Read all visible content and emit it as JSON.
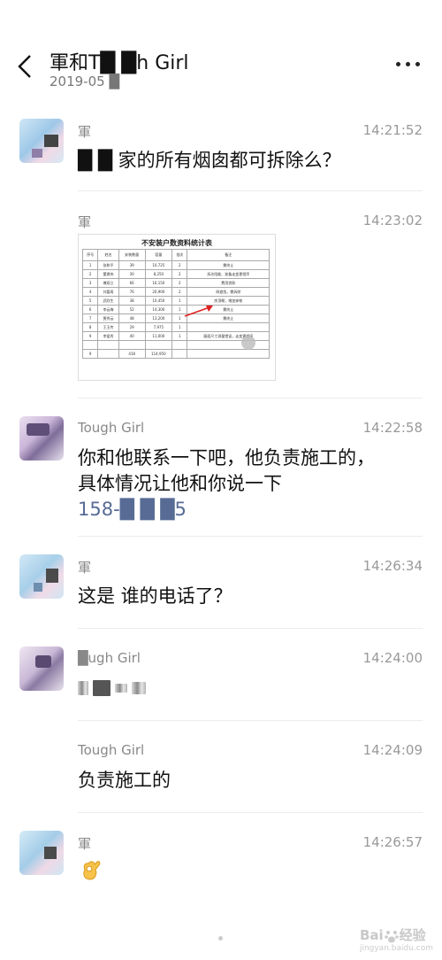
{
  "header": {
    "title": "軍和T█ █h Girl",
    "subtitle": "2019-05 █",
    "back_icon": "back-arrow-icon",
    "more_icon": "more-dots-icon"
  },
  "messages": [
    {
      "sender": "軍",
      "time": "14:21:52",
      "text": "█ █ 家的所有烟囱都可拆除么？"
    },
    {
      "sender": "軍",
      "time": "14:23:02",
      "image_title": "不安装户数资料统计表"
    },
    {
      "sender": "Tough Girl",
      "time": "14:22:58",
      "text": "你和他联系一下吧，他负责施工的，具体情况让他和你说一下",
      "phone": "158-█ █ █5"
    },
    {
      "sender": "軍",
      "time": "14:26:34",
      "text": "这是 谁的电话了？"
    },
    {
      "sender": "█ugh Girl",
      "time": "14:24:00",
      "text": ""
    },
    {
      "sender": "Tough Girl",
      "time": "14:24:09",
      "text": "负责施工的"
    },
    {
      "sender": "軍",
      "time": "14:26:57",
      "emoji": "ok-hand-emoji"
    }
  ],
  "doc_table": {
    "headers": [
      "序号",
      "姓名",
      "安装数量",
      "容量",
      "批次",
      "备注"
    ],
    "rows": [
      [
        "1",
        "张和平",
        "39",
        "10,725",
        "2",
        "需终止"
      ],
      [
        "2",
        "董建伟",
        "30",
        "8,250",
        "2",
        "拆次阳能、准备走变更程序"
      ],
      [
        "3",
        "傅双立",
        "66",
        "16,150",
        "2",
        "费用贷款"
      ],
      [
        "4",
        "刘喜再",
        "76",
        "20,900",
        "2",
        "树遮挡，需拆除"
      ],
      [
        "5",
        "武欣生",
        "38",
        "10,450",
        "1",
        "房顶朝，增加抹铁"
      ],
      [
        "6",
        "李云梅",
        "52",
        "14,300",
        "1",
        "需终止"
      ],
      [
        "7",
        "贾秀云",
        "48",
        "13,200",
        "1",
        "需终止"
      ],
      [
        "8",
        "王玉传",
        "29",
        "7,975",
        "1",
        ""
      ],
      [
        "9",
        "李爱秀",
        "40",
        "11,000",
        "1",
        "屋面尺寸测量错误，走变更程序"
      ]
    ],
    "total_label": "9",
    "total_qty": "418",
    "total_capacity": "114,950"
  },
  "watermark": {
    "text": "Bai",
    "sub": "jingyan.baidu.com",
    "suffix": "经验"
  }
}
